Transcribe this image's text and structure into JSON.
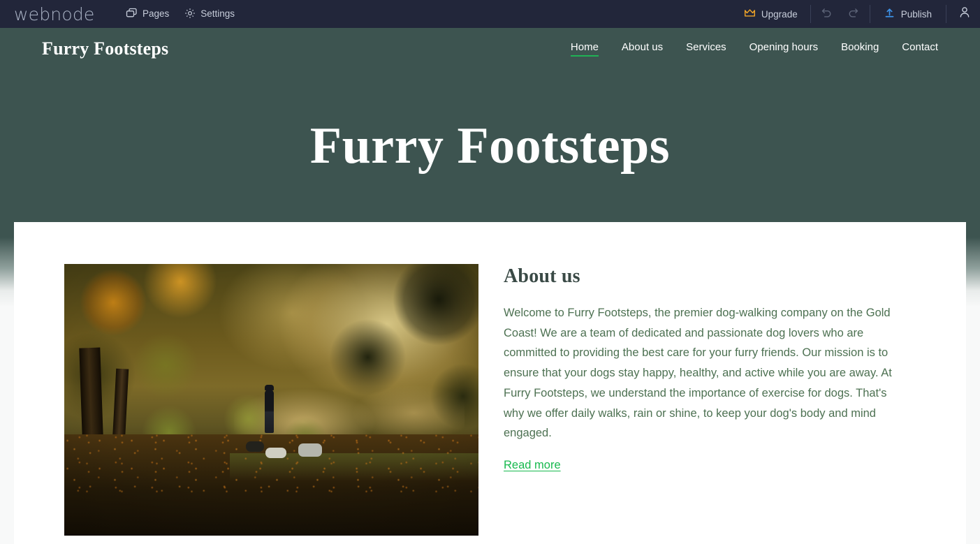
{
  "editor": {
    "brand": "webnode",
    "left_items": [
      {
        "label": "Pages",
        "icon": "pages-icon"
      },
      {
        "label": "Settings",
        "icon": "gear-icon"
      }
    ],
    "upgrade": {
      "label": "Upgrade",
      "icon": "crown-icon",
      "color": "#f0a427"
    },
    "undo": {
      "icon": "undo-icon"
    },
    "redo": {
      "icon": "redo-icon"
    },
    "publish": {
      "label": "Publish",
      "icon": "upload-icon",
      "color": "#3d92e8"
    },
    "account": {
      "icon": "user-icon"
    },
    "bar_color": "#22263a"
  },
  "site": {
    "logo": "Furry Footsteps",
    "theme_color": "#3d5450",
    "accent_color": "#1fb255",
    "nav": [
      {
        "label": "Home",
        "active": true
      },
      {
        "label": "About us",
        "active": false
      },
      {
        "label": "Services",
        "active": false
      },
      {
        "label": "Opening hours",
        "active": false
      },
      {
        "label": "Booking",
        "active": false
      },
      {
        "label": "Contact",
        "active": false
      }
    ],
    "hero": {
      "title": "Furry Footsteps"
    },
    "about": {
      "heading": "About us",
      "body": "Welcome to Furry Footsteps, the premier dog-walking company on the Gold Coast! We are a team of dedicated and passionate dog lovers who are committed to providing the best care for your furry friends. Our mission is to ensure that your dogs stay happy, healthy, and active while you are away. At Furry Footsteps, we understand the importance of exercise for dogs. That's why we offer daily walks, rain or shine, to keep your dog's body and mind engaged.",
      "read_more": "Read more",
      "image_alt": "Person walking three dogs through an autumn park at golden hour"
    }
  }
}
